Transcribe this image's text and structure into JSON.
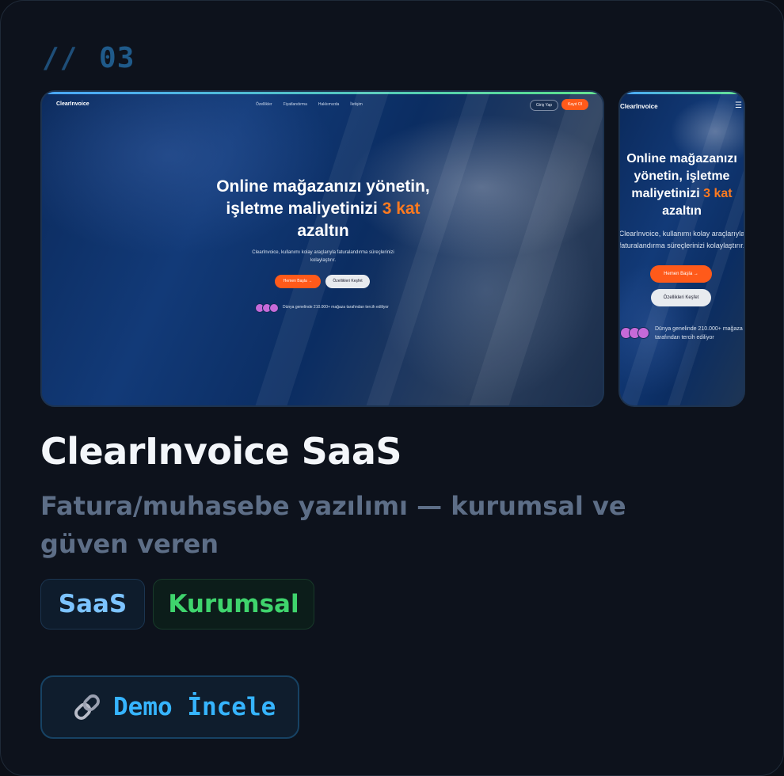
{
  "card": {
    "number": "03",
    "number_prefix": "//",
    "title": "ClearInvoice SaaS",
    "description": "Fatura/muhasebe yazılımı — kurumsal ve güven veren",
    "tags": [
      "SaaS",
      "Kurumsal"
    ],
    "demo_button": "Demo İncele",
    "demo_icon": "link-icon"
  },
  "desktop_preview": {
    "logo": "ClearInvoice",
    "nav": [
      "Özellikler",
      "Fiyatlandırma",
      "Hakkımızda",
      "İletişim"
    ],
    "login": "Giriş Yap",
    "signup": "Kayıt Ol",
    "headline_part1": "Online mağazanızı yönetin, işletme maliyetinizi",
    "headline_highlight": "3 kat",
    "headline_part2": "azaltın",
    "subtext": "ClearInvoice, kullanımı kolay araçlarıyla faturalandırma süreçlerinizi kolaylaştırır.",
    "primary_cta": "Hemen Başla",
    "secondary_cta": "Özellikleri Keşfet",
    "social_proof": "Dünya genelinde 210.000+ mağaza tarafından tercih ediliyor"
  },
  "mobile_preview": {
    "logo": "ClearInvoice",
    "menu_icon": "hamburger-icon",
    "headline_part1": "Online mağazanızı yönetin, işletme maliyetinizi",
    "headline_highlight": "3 kat",
    "headline_part2": "azaltın",
    "subtext": "ClearInvoice, kullanımı kolay araçlarıyla faturalandırma süreçlerinizi kolaylaştırır.",
    "primary_cta": "Hemen Başla",
    "secondary_cta": "Özellikleri Keşfet",
    "social_proof": "Dünya genelinde 210.000+ mağaza tarafından tercih ediliyor"
  },
  "colors": {
    "accent_orange": "#ff5a1a",
    "tag_saas": "#7cc3ff",
    "tag_kurumsal": "#3fd46d",
    "demo_text": "#36b4ff"
  }
}
